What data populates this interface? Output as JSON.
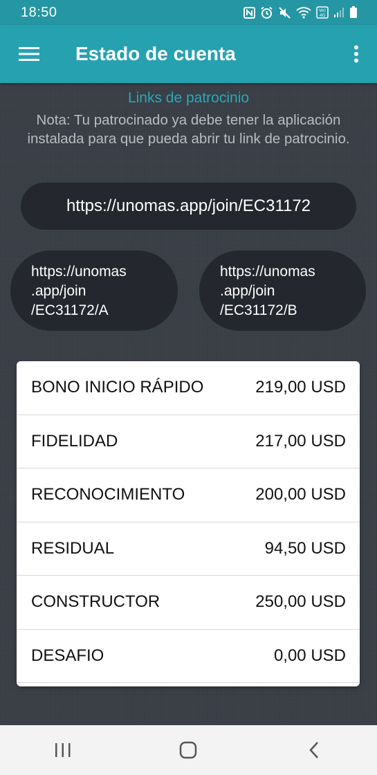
{
  "status_bar": {
    "time": "18:50",
    "icons": [
      "nfc-icon",
      "alarm-icon",
      "mute-icon",
      "wifi-icon",
      "volte-4g-icon",
      "signal-icon",
      "battery-icon"
    ],
    "volte_label": "Vo) 4G"
  },
  "app_bar": {
    "title": "Estado de cuenta",
    "color": "#26a1b0"
  },
  "links": {
    "title": "Links de patrocinio",
    "note": "Nota: Tu patrocinado ya debe tener la aplicación instalada para que pueda abrir tu link de patrocinio.",
    "main_link": "https://unomas.app/join/EC31172",
    "link_a": [
      "https://unomas",
      ".app/join",
      "/EC31172/A"
    ],
    "link_b": [
      "https://unomas",
      ".app/join",
      "/EC31172/B"
    ]
  },
  "bonuses": [
    {
      "label": "BONO INICIO RÁPIDO",
      "amount": "219,00 USD"
    },
    {
      "label": "FIDELIDAD",
      "amount": "217,00 USD"
    },
    {
      "label": "RECONOCIMIENTO",
      "amount": "200,00 USD"
    },
    {
      "label": "RESIDUAL",
      "amount": "94,50 USD"
    },
    {
      "label": "CONSTRUCTOR",
      "amount": "250,00 USD"
    },
    {
      "label": "DESAFIO",
      "amount": "0,00 USD"
    }
  ],
  "nav_bar": {
    "buttons": [
      "recent-apps-icon",
      "home-icon",
      "back-icon"
    ]
  }
}
